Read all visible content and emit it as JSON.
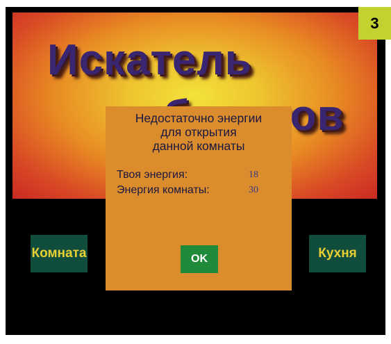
{
  "game": {
    "title_line_1": "Искатель",
    "title_line_2": "объектов",
    "rooms": {
      "left_label": "Комната",
      "right_label": "Кухня"
    }
  },
  "dialog": {
    "message_lines": [
      "Недостаточно энергии",
      "для открытия",
      "данной комнаты"
    ],
    "player_energy_label": "Твоя энергия:",
    "player_energy_value": "18",
    "room_energy_label": "Энергия комнаты:",
    "room_energy_value": "30",
    "ok_label": "OK"
  },
  "badge": {
    "step_number": "3"
  },
  "colors": {
    "background": "#000000",
    "dialog_background": "#db8c2c",
    "room_button": "#114d3c",
    "room_button_text": "#e8cf34",
    "ok_button": "#1e8a3a",
    "title_text": "#3a2570",
    "badge": "#c3d230"
  }
}
